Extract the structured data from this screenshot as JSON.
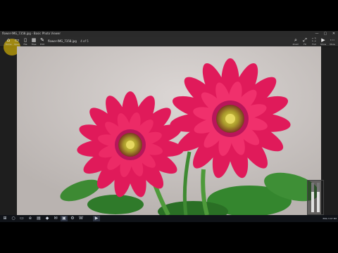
{
  "window": {
    "title": "flower-IMG_7358.jpg - Basic Photo Viewer",
    "controls": {
      "minimize": "—",
      "maximize": "▢",
      "close": "✕"
    }
  },
  "toolbar": {
    "left_items": [
      {
        "icon": "home-icon",
        "glyph": "⌂",
        "label": "Home"
      },
      {
        "icon": "folder-icon",
        "glyph": "▭",
        "label": "Open"
      },
      {
        "icon": "document-icon",
        "glyph": "▯",
        "label": "File"
      },
      {
        "icon": "grid-icon",
        "glyph": "▦",
        "label": "Tiles"
      },
      {
        "icon": "edit-icon",
        "glyph": "✎",
        "label": "Edit"
      }
    ],
    "file_path": "flower-IMG_7358.jpg",
    "counter": "4 of 5",
    "right_items": [
      {
        "icon": "zoom-icon",
        "glyph": "⌕",
        "label": "Zoom"
      },
      {
        "icon": "fit-icon",
        "glyph": "⤢",
        "label": "Fit"
      },
      {
        "icon": "fullscreen-icon",
        "glyph": "⛶",
        "label": "Full"
      },
      {
        "icon": "slideshow-icon",
        "glyph": "▶",
        "label": "Show"
      },
      {
        "icon": "more-icon",
        "glyph": "⋯",
        "label": "More"
      }
    ]
  },
  "volume": {
    "level": 0.7
  },
  "taskbar": {
    "items": [
      "start-icon",
      "search-icon",
      "taskview-icon",
      "edge-icon",
      "explorer-icon",
      "store-icon",
      "mail-icon",
      "photos-icon",
      "settings-icon",
      "word-icon",
      "media-icon"
    ],
    "glyphs": [
      "⊞",
      "○",
      "▭",
      "e",
      "▤",
      "◆",
      "✉",
      "▣",
      "⚙",
      "W",
      "▶"
    ],
    "tray_text": "ENG  3:07 PM"
  },
  "colors": {
    "petal": "#e01a5a",
    "center": "#c9b237",
    "leaf": "#2f7a2a"
  }
}
